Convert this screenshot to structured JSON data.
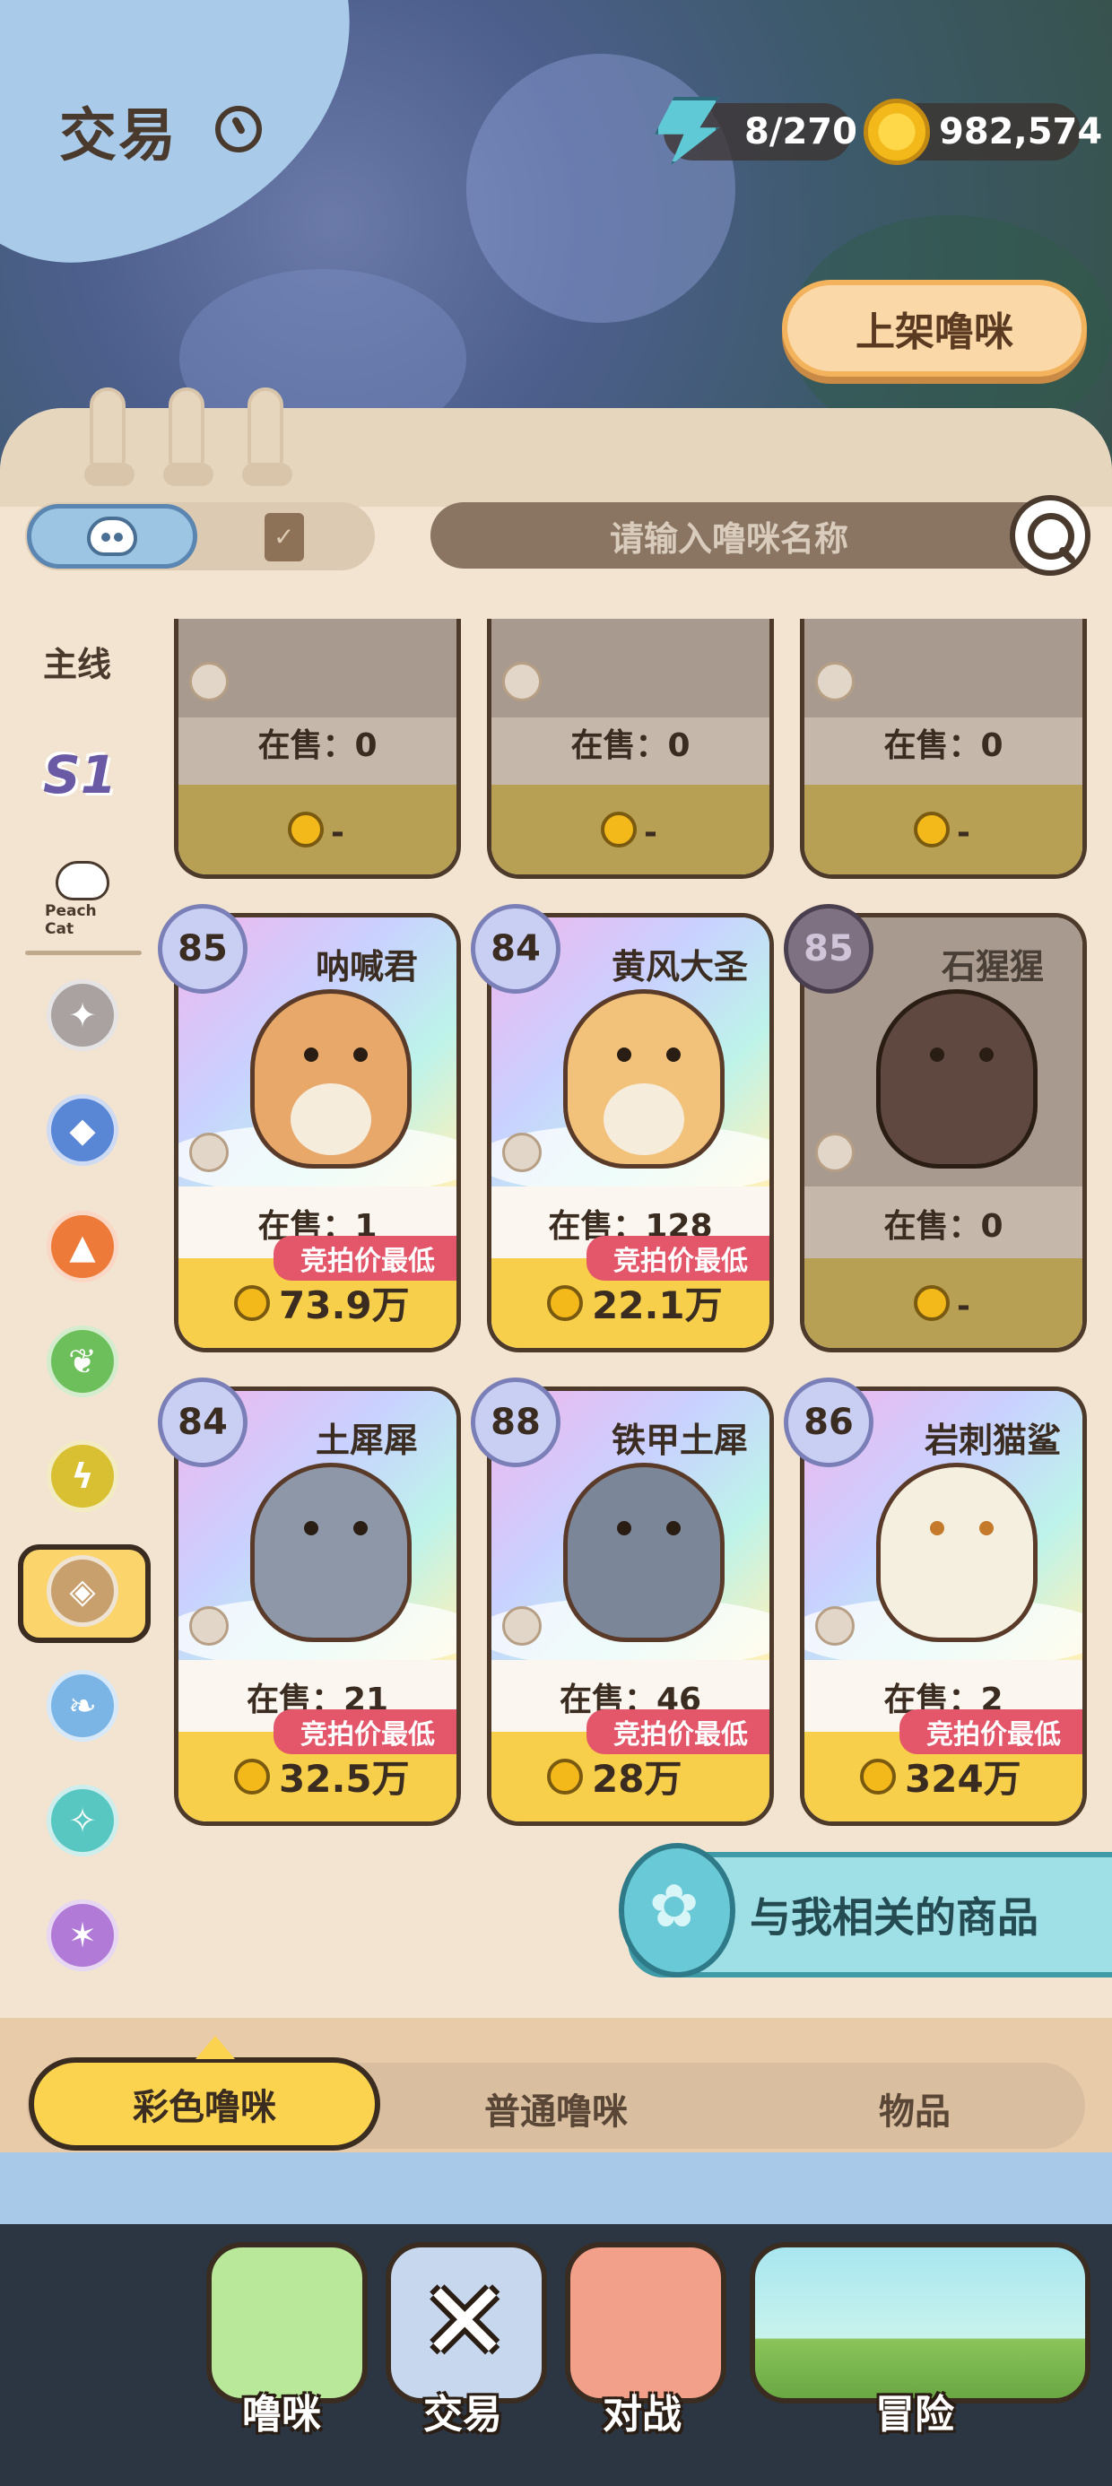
{
  "header": {
    "title": "交易",
    "energy": "8/270",
    "coins": "982,574",
    "list_button": "上架噜咪"
  },
  "search": {
    "placeholder": "请输入噜咪名称"
  },
  "sidebar": {
    "mainline": "主线",
    "season": "S1",
    "brand": "Peach Cat",
    "elements": [
      {
        "name": "neutral",
        "color": "#a9a2a0",
        "glyph": "✦"
      },
      {
        "name": "water",
        "color": "#5a86d6",
        "glyph": "💧"
      },
      {
        "name": "fire",
        "color": "#ee7a3a",
        "glyph": "🔥"
      },
      {
        "name": "grass",
        "color": "#6cbf5a",
        "glyph": "❦"
      },
      {
        "name": "electric",
        "color": "#d8c032",
        "glyph": "⚡"
      },
      {
        "name": "earth",
        "color": "#c8a06e",
        "glyph": "⬦"
      },
      {
        "name": "wind",
        "color": "#7ab5e6",
        "glyph": "❧"
      },
      {
        "name": "ice",
        "color": "#58c7c1",
        "glyph": "✧"
      },
      {
        "name": "mystic",
        "color": "#b07ad6",
        "glyph": "✶"
      }
    ]
  },
  "cards_top": [
    {
      "on_sale": "在售：0",
      "price": "-"
    },
    {
      "on_sale": "在售：0",
      "price": "-"
    },
    {
      "on_sale": "在售：0",
      "price": "-"
    }
  ],
  "cards": [
    {
      "name": "呐喊君",
      "level": "85",
      "on_sale": "在售：1",
      "tag": "竞拍价最低",
      "price": "73.9万",
      "available": true,
      "color": "#e8a86a"
    },
    {
      "name": "黄风大圣",
      "level": "84",
      "on_sale": "在售：128",
      "tag": "竞拍价最低",
      "price": "22.1万",
      "available": true,
      "color": "#f2c27a"
    },
    {
      "name": "石猩猩",
      "level": "85",
      "on_sale": "在售：0",
      "tag": "",
      "price": "-",
      "available": false,
      "color": "#5e4840"
    },
    {
      "name": "土犀犀",
      "level": "84",
      "on_sale": "在售：21",
      "tag": "竞拍价最低",
      "price": "32.5万",
      "available": true,
      "color": "#8d97a8"
    },
    {
      "name": "铁甲土犀",
      "level": "88",
      "on_sale": "在售：46",
      "tag": "竞拍价最低",
      "price": "28万",
      "available": true,
      "color": "#7b8699"
    },
    {
      "name": "岩刺猫鲨",
      "level": "86",
      "on_sale": "在售：2",
      "tag": "竞拍价最低",
      "price": "324万",
      "available": true,
      "color": "#f5efe0"
    }
  ],
  "related_button": "与我相关的商品",
  "category_tabs": [
    "彩色噜咪",
    "普通噜咪",
    "物品"
  ],
  "nav": [
    {
      "label": "噜咪",
      "color": "#b9e89a"
    },
    {
      "label": "交易",
      "color": "#c7d8ee"
    },
    {
      "label": "对战",
      "color": "#f2a08a"
    },
    {
      "label": "冒险",
      "color": "#a9e6f0"
    }
  ]
}
